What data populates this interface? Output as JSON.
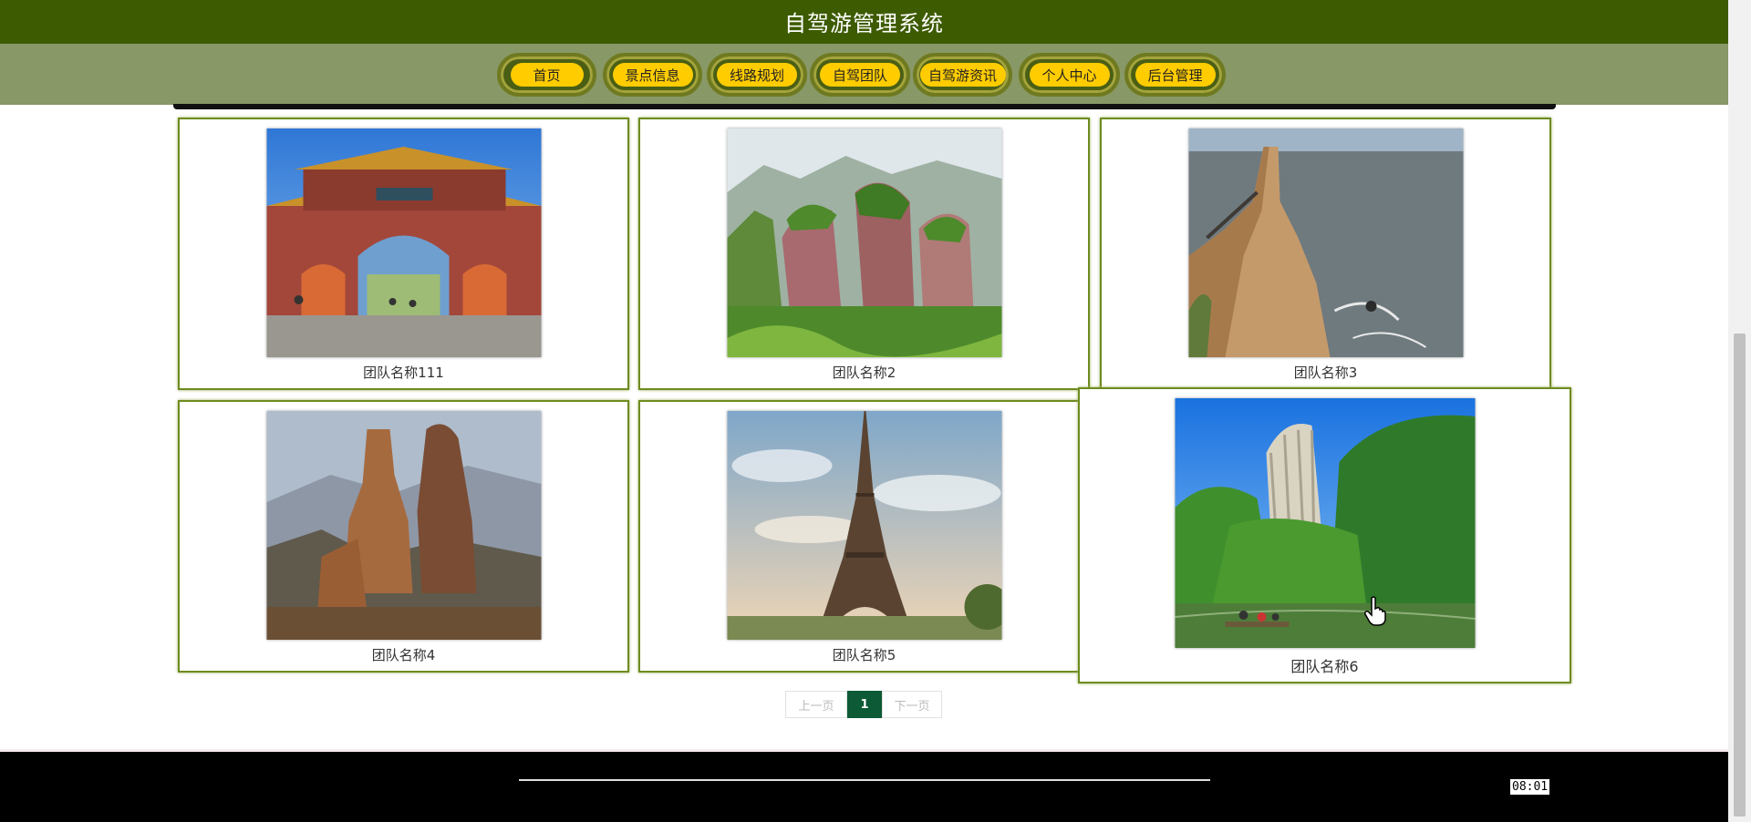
{
  "header": {
    "title": "自驾游管理系统"
  },
  "nav": {
    "items": [
      {
        "label": "首页"
      },
      {
        "label": "景点信息"
      },
      {
        "label": "线路规划"
      },
      {
        "label": "自驾团队"
      },
      {
        "label": "自驾游资讯"
      },
      {
        "label": "个人中心"
      },
      {
        "label": "后台管理"
      }
    ]
  },
  "cards": [
    {
      "name": "团队名称111",
      "image": "paifang-gate-image"
    },
    {
      "name": "团队名称2",
      "image": "red-rock-mountain-image"
    },
    {
      "name": "团队名称3",
      "image": "sea-cliff-image"
    },
    {
      "name": "团队名称4",
      "image": "rock-pillars-image"
    },
    {
      "name": "团队名称5",
      "image": "eiffel-tower-image"
    },
    {
      "name": "团队名称6",
      "image": "river-bamboo-raft-image"
    }
  ],
  "pager": {
    "prev": "上一页",
    "current": "1",
    "next": "下一页"
  },
  "footer": {
    "time": "08:01"
  }
}
